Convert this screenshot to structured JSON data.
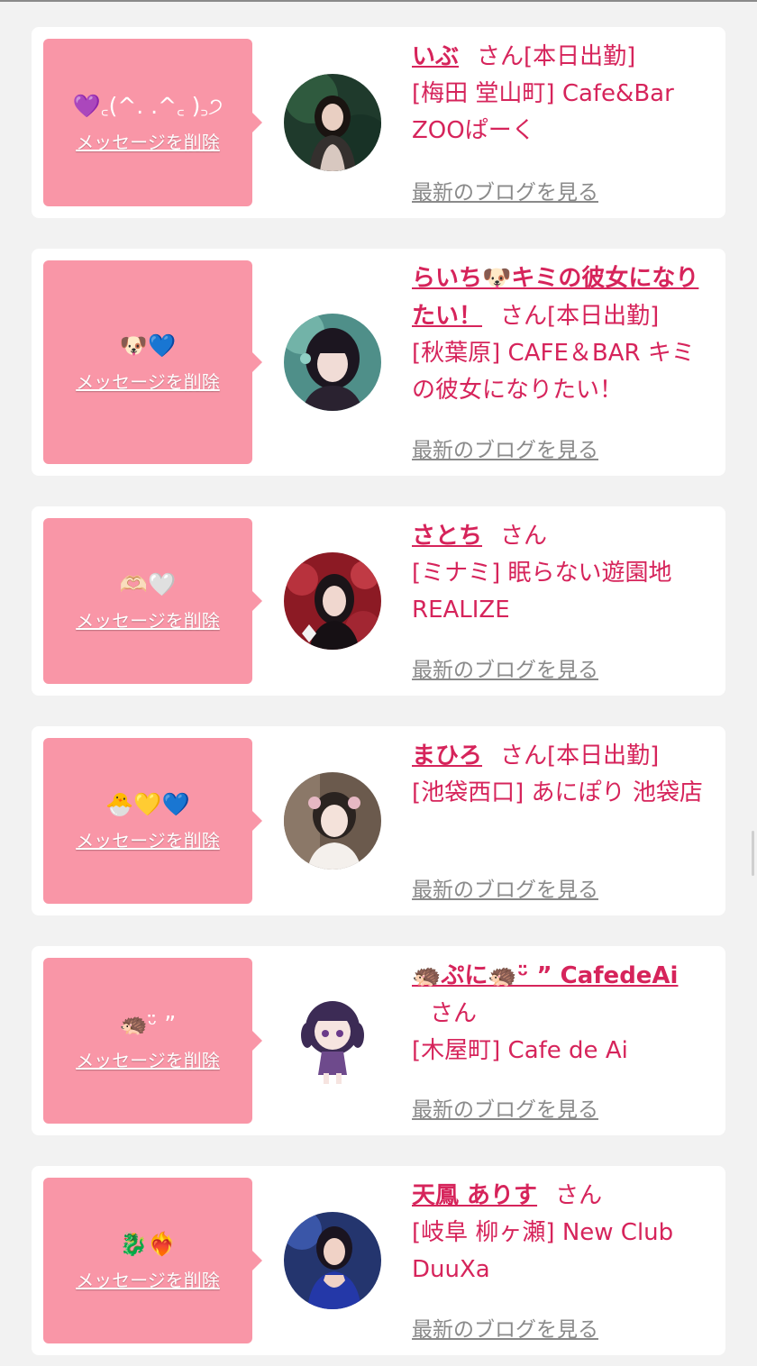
{
  "delete_label": "メッセージを削除",
  "san_label": "さん",
  "blog_label": "最新のブログを見る",
  "colors": {
    "bubble": "#f996a7",
    "accent": "#d6245b",
    "muted": "#8a8a8a",
    "bg": "#f2f2f2"
  },
  "cards": [
    {
      "message": "💜꜀(^. .^꜀ )꜆੭",
      "name": "いぶ",
      "status": "[本日出勤]",
      "shop": "[梅田 堂山町] Cafe&Bar ZOOぱーく"
    },
    {
      "message": "🐶💙",
      "name": "らいち🐶キミの彼女になりたい！",
      "status": "[本日出勤]",
      "shop": "[秋葉原] CAFE＆BAR キミの彼女になりたい！"
    },
    {
      "message": "🫶🏻🤍",
      "name": "さとち",
      "status": "",
      "shop": "[ミナミ] 眠らない遊園地REALIZE"
    },
    {
      "message": "🐣💛💙",
      "name": "まひろ",
      "status": "[本日出勤]",
      "shop": "[池袋西口] あにぽり 池袋店"
    },
    {
      "message": "🦔ᵕ̈ ”",
      "name": "🦔ぷに🦔ᵕ̈ ” CafedeAi",
      "status": "",
      "shop": "[木屋町] Cafe de Ai"
    },
    {
      "message": "🐉❤️‍🔥",
      "name": "天鳳 ありす",
      "status": "",
      "shop": "[岐阜 柳ヶ瀬] New Club DuuXa"
    }
  ]
}
